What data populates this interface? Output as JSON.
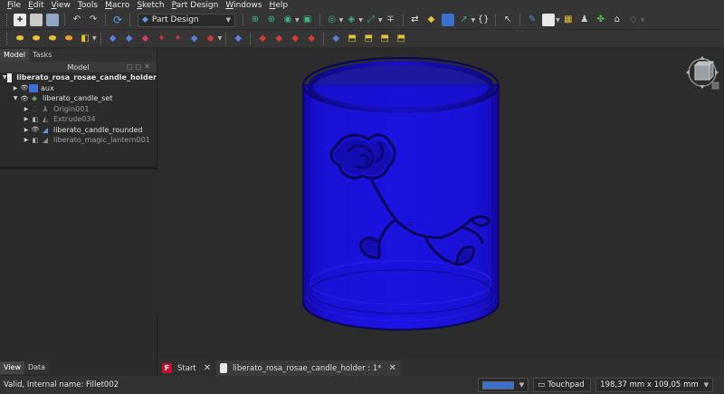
{
  "menubar": {
    "items": [
      {
        "label": "File",
        "key": "F",
        "rest": "ile"
      },
      {
        "label": "Edit",
        "key": "E",
        "rest": "dit"
      },
      {
        "label": "View",
        "key": "V",
        "rest": "iew"
      },
      {
        "label": "Tools",
        "key": "T",
        "rest": "ools"
      },
      {
        "label": "Macro",
        "key": "M",
        "rest": "acro"
      },
      {
        "label": "Sketch",
        "key": "S",
        "rest": "ketch"
      },
      {
        "label": "Part Design",
        "key": "P",
        "rest": "art Design"
      },
      {
        "label": "Windows",
        "key": "W",
        "rest": "indows"
      },
      {
        "label": "Help",
        "key": "H",
        "rest": "elp"
      }
    ]
  },
  "toolbar": {
    "workbench": "Part Design"
  },
  "left_panel": {
    "tabs": [
      "Model",
      "Tasks"
    ],
    "header": "Model",
    "bottom_tabs": [
      "View",
      "Data"
    ]
  },
  "tree": {
    "root": "liberato_rosa_rosae_candle_holder",
    "items": [
      {
        "label": "aux",
        "icon": "folder-icon"
      },
      {
        "label": "liberato_candle_set",
        "icon": "body-icon"
      },
      {
        "label": "Origin001",
        "icon": "origin-icon"
      },
      {
        "label": "Extrude034",
        "icon": "extrude-icon"
      },
      {
        "label": "liberato_candle_rounded",
        "icon": "fillet-icon"
      },
      {
        "label": "liberato_magic_lantern001",
        "icon": "fillet-icon"
      }
    ]
  },
  "doc_tabs": [
    {
      "label": "Start"
    },
    {
      "label": "liberato_rosa_rosae_candle_holder : 1*"
    }
  ],
  "status": {
    "message": "Valid, Internal name: Fillet002",
    "nav_style": "Touchpad",
    "dimensions": "198,37 mm x 109,05 mm"
  },
  "colors": {
    "model_blue": "#1a12d8",
    "background": "#2c2c2c"
  }
}
